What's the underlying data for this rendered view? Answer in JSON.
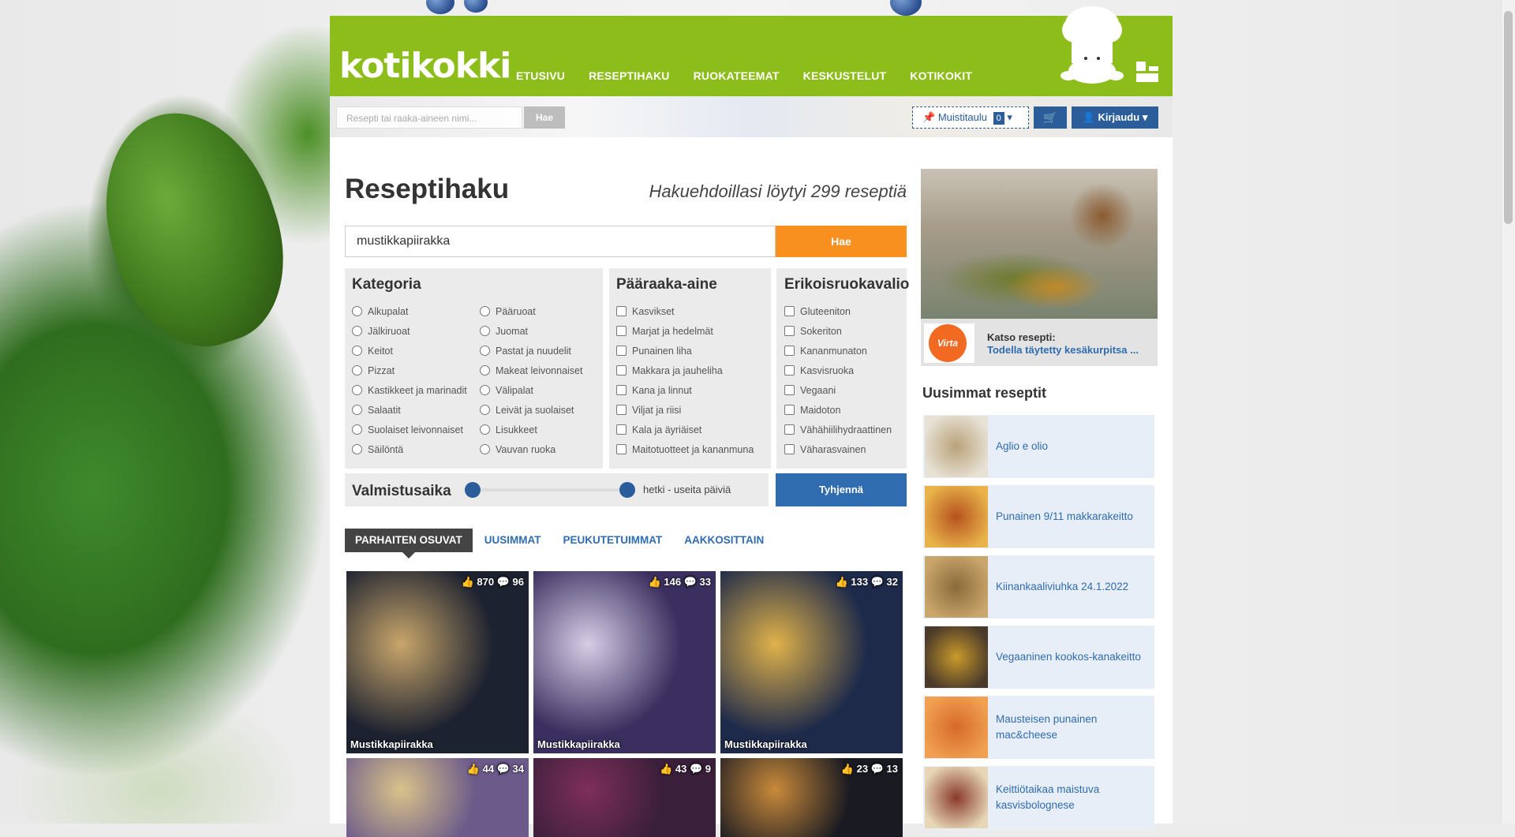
{
  "brand": {
    "logo_text": "kotikokki",
    "green": "#8cbd1a",
    "blue": "#2a5d9a",
    "orange": "#f7901e"
  },
  "nav": [
    "ETUSIVU",
    "RESEPTIHAKU",
    "RUOKATEEMAT",
    "KESKUSTELUT",
    "KOTIKOKIT"
  ],
  "topbar": {
    "search_placeholder": "Resepti tai raaka-aineen nimi...",
    "search_button": "Hae",
    "memo_label": "Muistitaulu",
    "memo_count": "0",
    "login_label": "Kirjaudu"
  },
  "search": {
    "title": "Reseptihaku",
    "results_text": "Hakuehdoillasi löytyi 299 reseptiä",
    "query": "mustikkapiirakka",
    "button": "Hae"
  },
  "filters": {
    "kategoria": {
      "title": "Kategoria",
      "col1": [
        "Alkupalat",
        "Jälkiruoat",
        "Keitot",
        "Pizzat",
        "Kastikkeet ja marinadit",
        "Salaatit",
        "Suolaiset leivonnaiset",
        "Säilöntä"
      ],
      "col2": [
        "Pääruoat",
        "Juomat",
        "Pastat ja nuudelit",
        "Makeat leivonnaiset",
        "Välipalat",
        "Leivät ja suolaiset",
        "Lisukkeet",
        "Vauvan ruoka"
      ]
    },
    "paaraaka": {
      "title": "Pääraaka-aine",
      "items": [
        "Kasvikset",
        "Marjat ja hedelmät",
        "Punainen liha",
        "Makkara ja jauheliha",
        "Kana ja linnut",
        "Viljat ja riisi",
        "Kala ja äyriäiset",
        "Maitotuotteet ja kananmuna"
      ]
    },
    "erikois": {
      "title": "Erikoisruokavalio",
      "items": [
        "Gluteeniton",
        "Sokeriton",
        "Kananmunaton",
        "Kasvisruoka",
        "Vegaani",
        "Maidoton",
        "Vähähiilihydraattinen",
        "Väharasvainen"
      ]
    },
    "valmistusaika": {
      "label": "Valmistusaika",
      "range_text": "hetki - useita päiviä"
    },
    "clear_button": "Tyhjennä"
  },
  "sort_tabs": [
    "PARHAITEN OSUVAT",
    "UUSIMMAT",
    "PEUKUTETUIMMAT",
    "AAKKOSITTAIN"
  ],
  "results": [
    {
      "title": "Mustikkapiirakka",
      "likes": "870",
      "comments": "96",
      "palette": [
        "#1d2230",
        "#c9a66b"
      ]
    },
    {
      "title": "Mustikkapiirakka",
      "likes": "146",
      "comments": "33",
      "palette": [
        "#3a2f5e",
        "#d8cde6"
      ]
    },
    {
      "title": "Mustikkapiirakka",
      "likes": "133",
      "comments": "32",
      "palette": [
        "#1e2a4a",
        "#e0b24a"
      ]
    },
    {
      "title": "",
      "likes": "44",
      "comments": "34",
      "palette": [
        "#6b5a8a",
        "#d9c28a"
      ]
    },
    {
      "title": "",
      "likes": "43",
      "comments": "9",
      "palette": [
        "#3a1f3a",
        "#7e2e5a"
      ]
    },
    {
      "title": "",
      "likes": "23",
      "comments": "13",
      "palette": [
        "#1a1a22",
        "#c98a3a"
      ]
    }
  ],
  "sidebar": {
    "ad_kicker": "Katso resepti:",
    "ad_title": "Todella täytetty kesäkurpitsa ...",
    "ad_logo": "Virta",
    "latest_title": "Uusimmat reseptit",
    "latest": [
      {
        "title": "Aglio e olio",
        "palette": [
          "#b9a27a",
          "#e8e2d6"
        ]
      },
      {
        "title": "Punainen 9/11 makkarakeitto",
        "palette": [
          "#b6521f",
          "#e9b34a"
        ]
      },
      {
        "title": "Kiinankaaliviuhka 24.1.2022",
        "palette": [
          "#8a6a3a",
          "#c9a66b"
        ]
      },
      {
        "title": "Vegaaninen kookos-kanakeitto",
        "palette": [
          "#c99a2a",
          "#4a3a2a"
        ]
      },
      {
        "title": "Mausteisen punainen mac&cheese",
        "palette": [
          "#d76a2a",
          "#f0a050"
        ]
      },
      {
        "title": "Keittiötaikaa maistuva kasvisbolognese",
        "palette": [
          "#8a3a2a",
          "#e7d7b7"
        ]
      }
    ]
  }
}
